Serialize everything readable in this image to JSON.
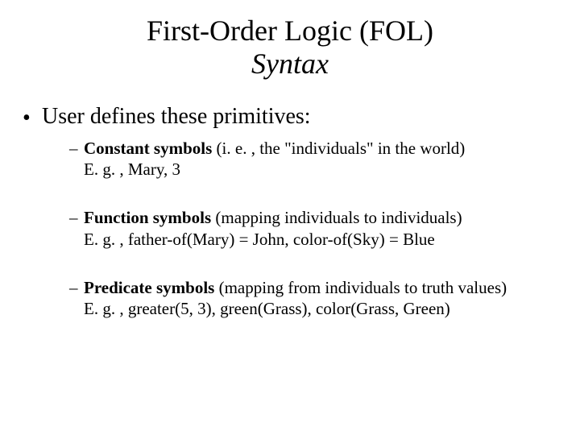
{
  "title": {
    "line1": "First-Order Logic (FOL)",
    "line2": "Syntax"
  },
  "body": {
    "l1": "User defines these primitives:",
    "items": [
      {
        "term": "Constant symbols",
        "desc": " (i. e. , the \"individuals\" in the world)",
        "example": "E. g. , Mary, 3"
      },
      {
        "term": "Function symbols",
        "desc": " (mapping individuals to individuals)",
        "example": "E. g. , father-of(Mary) = John, color-of(Sky) = Blue"
      },
      {
        "term": "Predicate symbols",
        "desc": " (mapping from individuals to truth values)",
        "example": "E. g. , greater(5, 3), green(Grass), color(Grass, Green)"
      }
    ]
  }
}
